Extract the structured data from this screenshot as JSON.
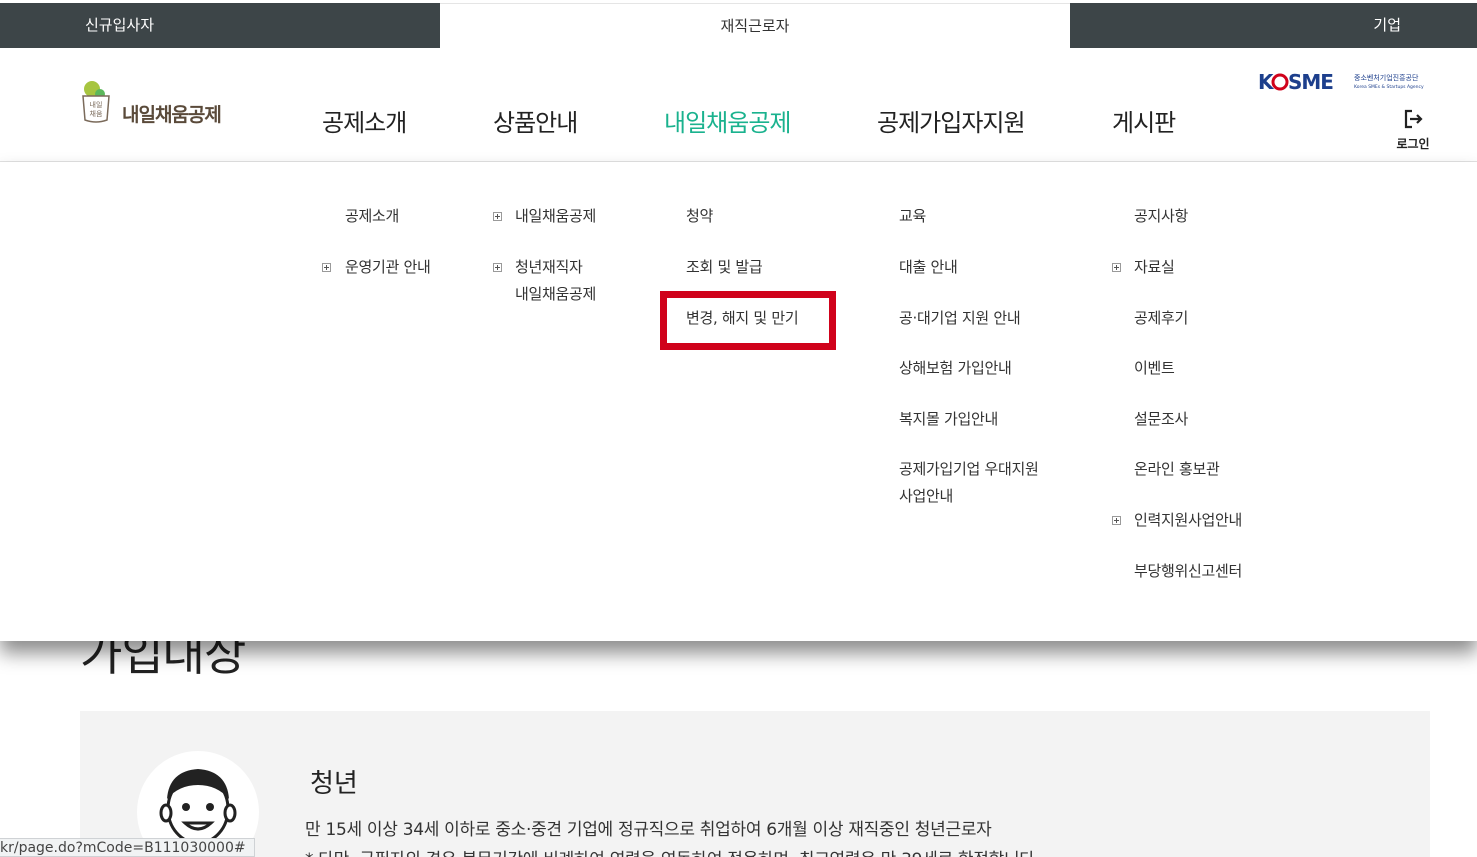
{
  "top_tabs": {
    "new_hire": "신규입사자",
    "current": "재직근로자",
    "company": "기업"
  },
  "header": {
    "logo_mark_text": "내일채움",
    "logo_text": "내일채움공제",
    "nav": [
      "공제소개",
      "상품안내",
      "내일채움공제",
      "공제가입자지원",
      "게시판"
    ],
    "active_nav": "내일채움공제",
    "kosme_logo": "KOSME",
    "kosme_kr": "중소벤처기업진흥공단",
    "kosme_en": "Korea SMEs & Startups Agency",
    "login_label": "로그인",
    "accent_color": "#1ab28e"
  },
  "mega_menu": {
    "col1": [
      "공제소개",
      "운영기관 안내"
    ],
    "col2": [
      "내일채움공제",
      "청년재직자",
      "내일채움공제"
    ],
    "col3": [
      "청약",
      "조회 및 발급",
      "변경, 해지 및 만기"
    ],
    "col4": [
      "교육",
      "대출 안내",
      "공·대기업 지원 안내",
      "상해보험 가입안내",
      "복지몰 가입안내",
      "공제가입기업 우대지원",
      "사업안내"
    ],
    "col5": [
      "공지사항",
      "자료실",
      "공제후기",
      "이벤트",
      "설문조사",
      "온라인 홍보관",
      "인력지원사업안내",
      "부당행위신고센터"
    ],
    "highlight_color": "#d0021b"
  },
  "content": {
    "page_title": "가입대상",
    "card_title": "청년",
    "card_desc": "만 15세 이상 34세 이하로 중소·중견 기업에 정규직으로 취업하여 6개월 이상 재직중인 청년근로자",
    "card_note": "* 다만, 군필자의 경우 복무기간에 비례하여 연령을 연동하여 적용하며, 최고연령은 만 39세로 한정합니다."
  },
  "status_url": "kr/page.do?mCode=B111030000#"
}
